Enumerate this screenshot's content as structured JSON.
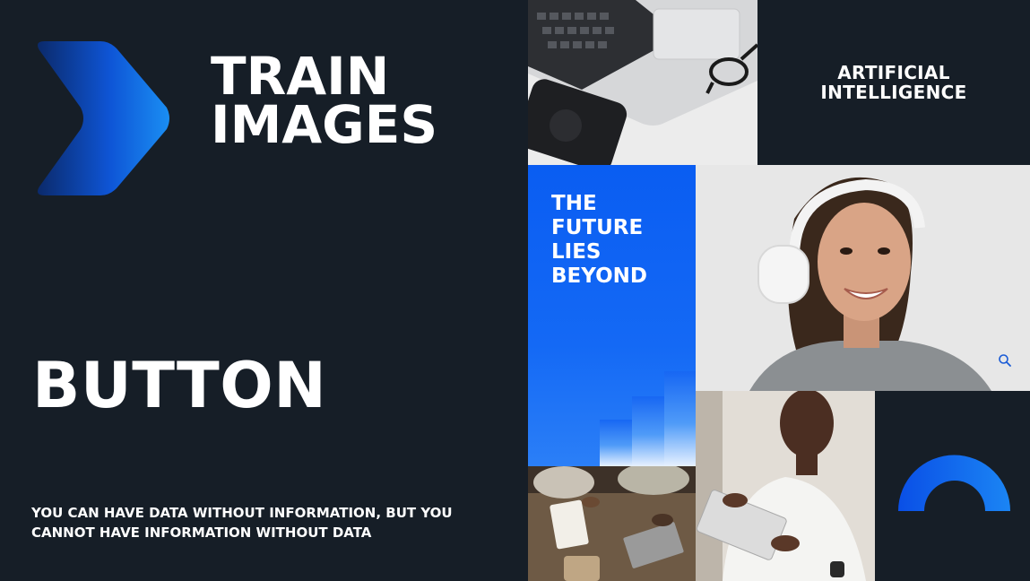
{
  "slide": {
    "title_lines": [
      "TRAIN",
      "IMAGES"
    ],
    "button_label": "BUTTON",
    "quote": "YOU CAN HAVE DATA WITHOUT INFORMATION, BUT YOU CANNOT HAVE INFORMATION WITHOUT DATA"
  },
  "collage": {
    "ai_label_lines": [
      "ARTIFICIAL",
      "INTELLIGENCE"
    ],
    "future_lines": [
      "THE",
      "FUTURE",
      "LIES",
      "BEYOND"
    ]
  },
  "icons": [
    "chevron-right-icon",
    "magnifier-icon",
    "bar-chart-graphic",
    "half-ring-graphic"
  ],
  "colors": {
    "background": "#161e27",
    "accent_blue": "#0a5df2",
    "light_blue": "#2b8cf7",
    "text": "#ffffff"
  }
}
